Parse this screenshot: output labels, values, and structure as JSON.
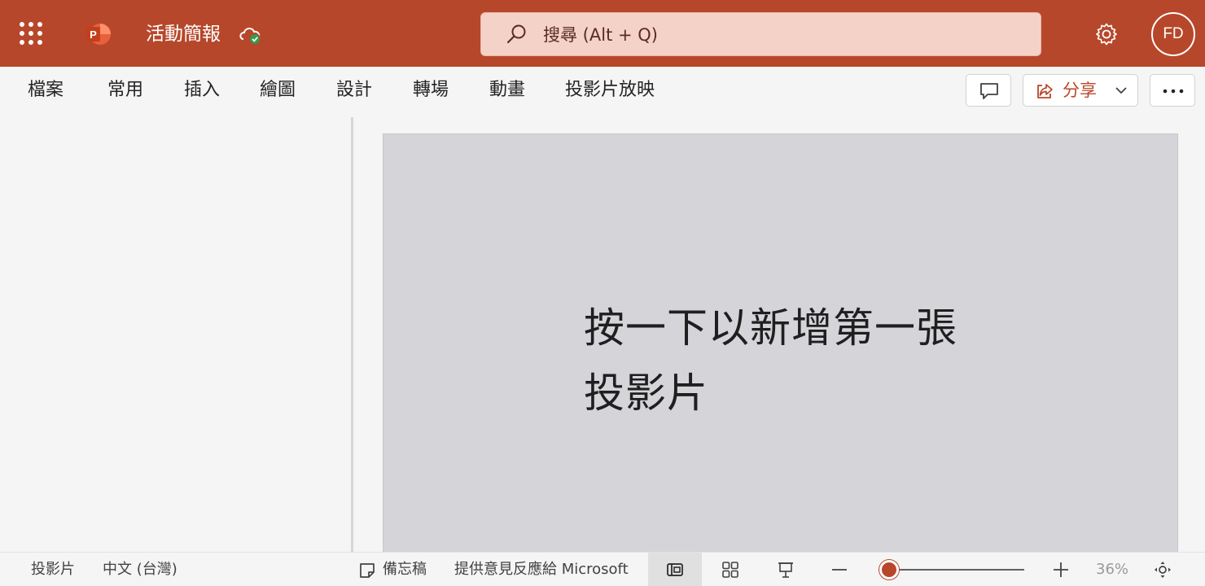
{
  "titlebar": {
    "document_title": "活動簡報",
    "search_placeholder": "搜尋 (Alt + Q)",
    "avatar_initials": "FD",
    "app_icon": "powerpoint-logo-icon",
    "colors": {
      "brand": "#b7472a",
      "search_bg": "#f4d2c8"
    }
  },
  "menu": {
    "tabs": [
      "檔案",
      "常用",
      "插入",
      "繪圖",
      "設計",
      "轉場",
      "動畫",
      "投影片放映"
    ],
    "share_label": "分享"
  },
  "slide": {
    "prompt_line1": "按一下以新增第一張",
    "prompt_line2": "投影片",
    "background": "#d4d4d9"
  },
  "statusbar": {
    "slide_label": "投影片",
    "language": "中文 (台灣)",
    "notes_label": "備忘稿",
    "feedback_label": "提供意見反應給 Microsoft",
    "zoom_percent": "36%",
    "zoom_level": 0.0
  }
}
